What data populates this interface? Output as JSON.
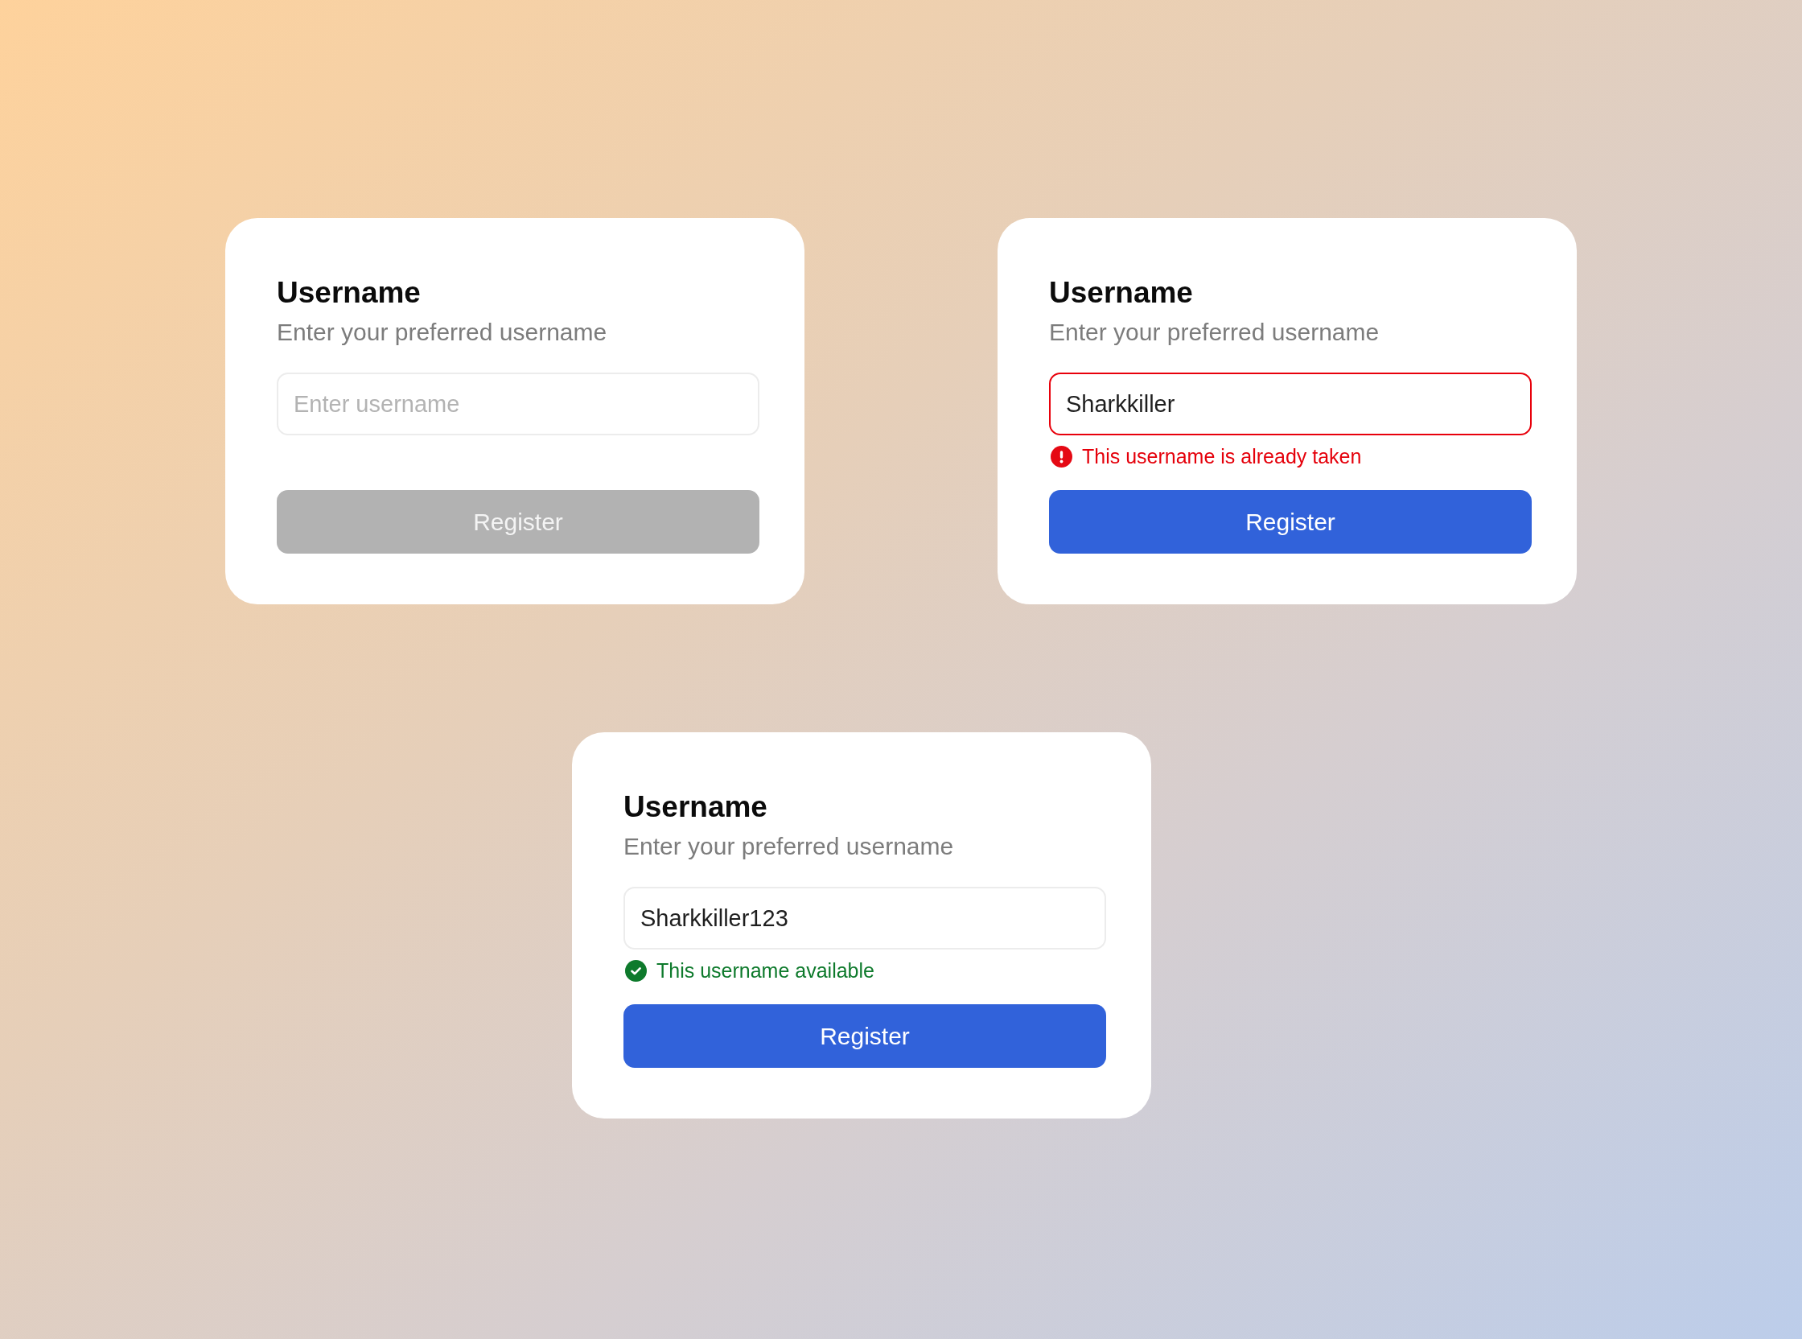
{
  "cards": [
    {
      "title": "Username",
      "subtitle": "Enter your preferred username",
      "input": {
        "placeholder": "Enter username",
        "invalid": false
      },
      "button": {
        "label": "Register",
        "disabled": true
      }
    },
    {
      "title": "Username",
      "subtitle": "Enter your preferred username",
      "input": {
        "value": "Sharkkiller",
        "invalid": true
      },
      "message": {
        "kind": "error",
        "text": "This username is already taken"
      },
      "button": {
        "label": "Register",
        "disabled": false
      }
    },
    {
      "title": "Username",
      "subtitle": "Enter your preferred username",
      "input": {
        "value": "Sharkkiller123",
        "invalid": false
      },
      "message": {
        "kind": "success",
        "text": "This username available"
      },
      "button": {
        "label": "Register",
        "disabled": false
      }
    }
  ]
}
